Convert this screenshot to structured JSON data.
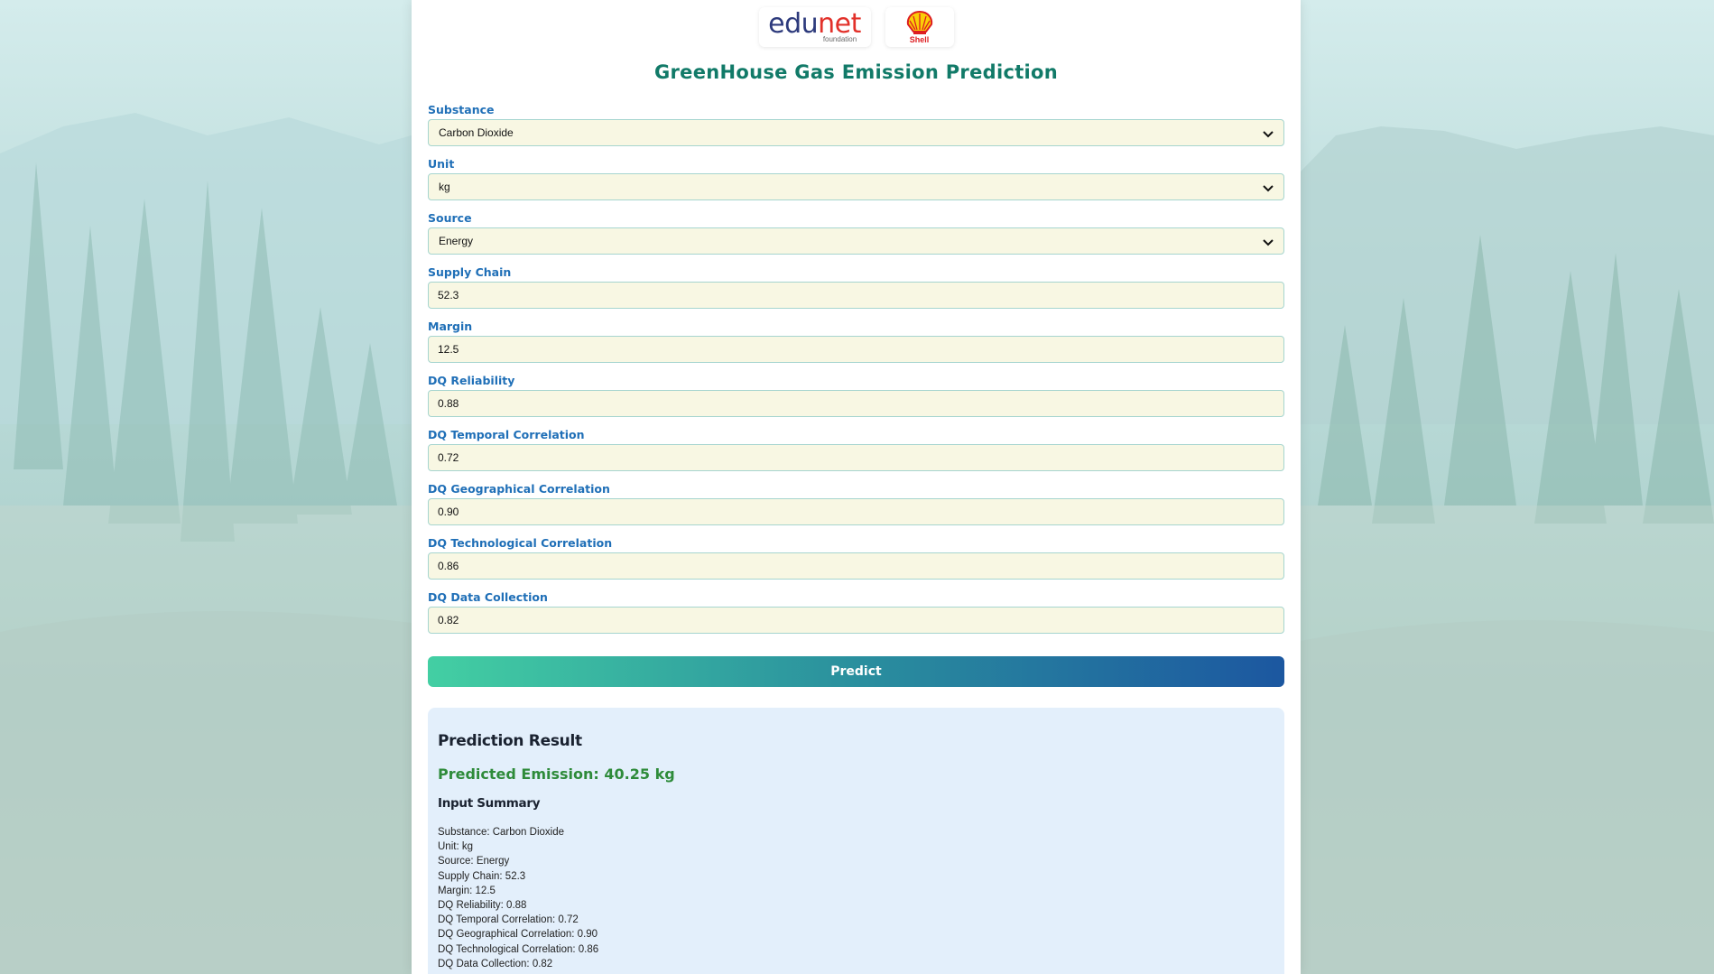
{
  "page": {
    "title": "GreenHouse Gas Emission Prediction",
    "logos": {
      "edunet": {
        "word_main": "edu",
        "word_accent": "net",
        "sub": "foundation"
      },
      "shell": {
        "word": "Shell"
      }
    }
  },
  "form": {
    "fields": [
      {
        "label": "Substance",
        "type": "select",
        "value": "Carbon Dioxide"
      },
      {
        "label": "Unit",
        "type": "select",
        "value": "kg"
      },
      {
        "label": "Source",
        "type": "select",
        "value": "Energy"
      },
      {
        "label": "Supply Chain",
        "type": "input",
        "value": "52.3"
      },
      {
        "label": "Margin",
        "type": "input",
        "value": "12.5"
      },
      {
        "label": "DQ Reliability",
        "type": "input",
        "value": "0.88"
      },
      {
        "label": "DQ Temporal Correlation",
        "type": "input",
        "value": "0.72"
      },
      {
        "label": "DQ Geographical Correlation",
        "type": "input",
        "value": "0.90"
      },
      {
        "label": "DQ Technological Correlation",
        "type": "input",
        "value": "0.86"
      },
      {
        "label": "DQ Data Collection",
        "type": "input",
        "value": "0.82"
      }
    ],
    "predict_label": "Predict"
  },
  "result": {
    "heading": "Prediction Result",
    "predicted": "Predicted Emission: 40.25 kg",
    "summary_heading": "Input Summary",
    "summary": [
      "Substance: Carbon Dioxide",
      "Unit: kg",
      "Source: Energy",
      "Supply Chain: 52.3",
      "Margin: 12.5",
      "DQ Reliability: 0.88",
      "DQ Temporal Correlation: 0.72",
      "DQ Geographical Correlation: 0.90",
      "DQ Technological Correlation: 0.86",
      "DQ Data Collection: 0.82"
    ]
  },
  "colors": {
    "title": "#117a68",
    "label": "#1f6fb7",
    "field_bg": "#f8f7e3",
    "field_border": "#a6d5cf",
    "predicted_text": "#2e8b3a",
    "result_bg": "#e3effb",
    "button_gradient_start": "#43cfa3",
    "button_gradient_end": "#1c57a0"
  },
  "icons": {
    "select_arrow": "chevron-down-icon",
    "shell_logo": "shell-logo-icon"
  }
}
